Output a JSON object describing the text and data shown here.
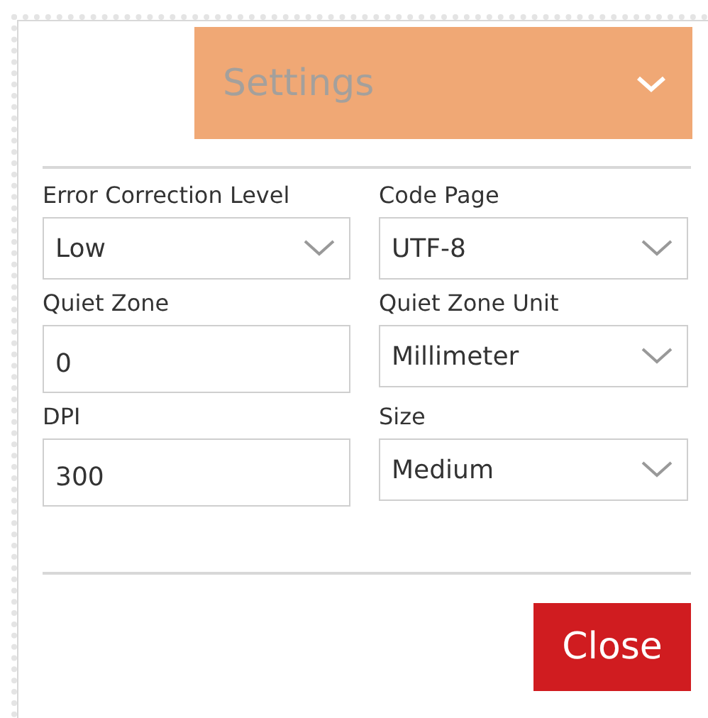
{
  "header": {
    "title": "Settings",
    "expanded": true
  },
  "fields": [
    {
      "label": "Error Correction Level",
      "kind": "select",
      "value": "Low"
    },
    {
      "label": "Code Page",
      "kind": "select",
      "value": "UTF-8"
    },
    {
      "label": "Quiet Zone",
      "kind": "input",
      "value": "0"
    },
    {
      "label": "Quiet Zone Unit",
      "kind": "select",
      "value": "Millimeter"
    },
    {
      "label": "DPI",
      "kind": "input",
      "value": "300"
    },
    {
      "label": "Size",
      "kind": "select",
      "value": "Medium"
    }
  ],
  "buttons": [
    {
      "label": "Close"
    }
  ]
}
